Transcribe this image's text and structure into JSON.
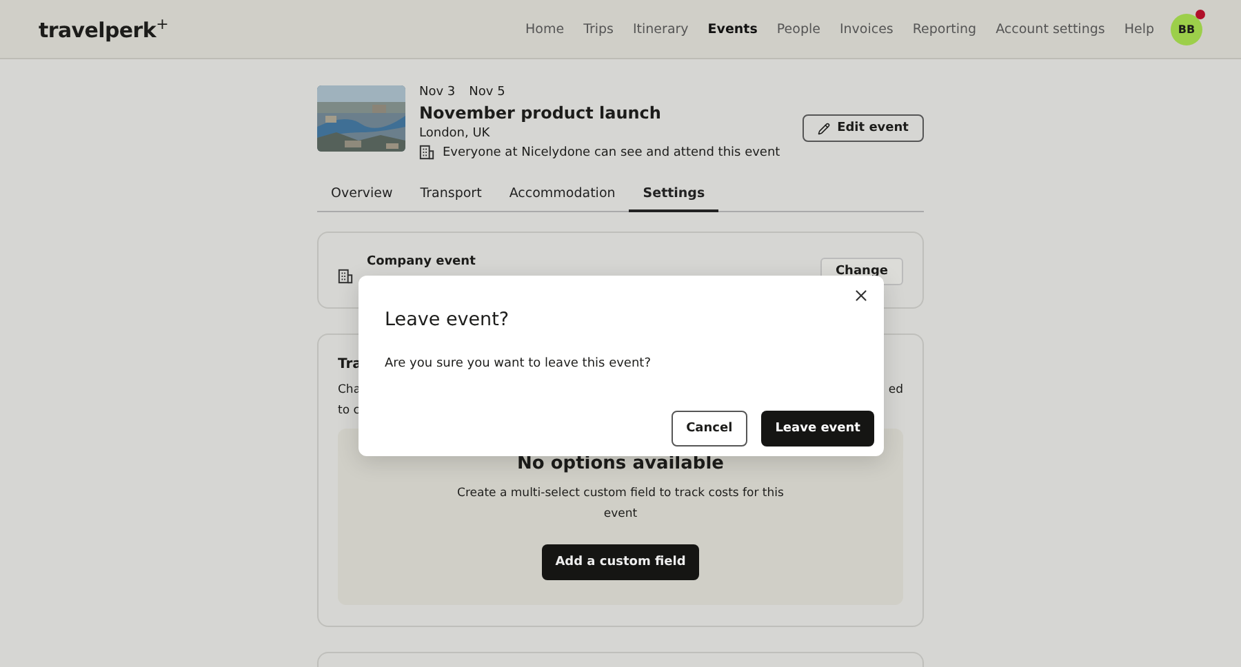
{
  "header": {
    "logo": "travelperk",
    "logo_mark": "+",
    "nav": [
      {
        "label": "Home",
        "selected": false
      },
      {
        "label": "Trips",
        "selected": false
      },
      {
        "label": "Itinerary",
        "selected": false
      },
      {
        "label": "Events",
        "selected": true
      },
      {
        "label": "People",
        "selected": false
      },
      {
        "label": "Invoices",
        "selected": false
      },
      {
        "label": "Reporting",
        "selected": false
      },
      {
        "label": "Account settings",
        "selected": false
      },
      {
        "label": "Help",
        "selected": false
      }
    ],
    "avatar": {
      "initials": "BB",
      "notification": true
    }
  },
  "event": {
    "start": "Nov 3",
    "end": "Nov 5",
    "title": "November product launch",
    "location": "London, UK",
    "visibility": "Everyone at Nicelydone can see and attend this event",
    "edit_button": "Edit event"
  },
  "tabs": [
    {
      "label": "Overview",
      "selected": false
    },
    {
      "label": "Transport",
      "selected": false
    },
    {
      "label": "Accommodation",
      "selected": false
    },
    {
      "label": "Settings",
      "selected": true
    }
  ],
  "company_card": {
    "title": "Company event",
    "button": "Change"
  },
  "tracking_card": {
    "title": "Tra",
    "description_start": [
      "Cha",
      "to c"
    ],
    "description_end": "ed",
    "empty": {
      "title": "No options available",
      "text": "Create a multi-select custom field to track costs for this event",
      "button": "Add a custom field"
    }
  },
  "dialog": {
    "title": "Leave event?",
    "message": "Are you sure you want to leave this event?",
    "buttons": [
      {
        "label": "Cancel",
        "kind": "secondary"
      },
      {
        "label": "Leave event",
        "kind": "primary"
      }
    ]
  }
}
